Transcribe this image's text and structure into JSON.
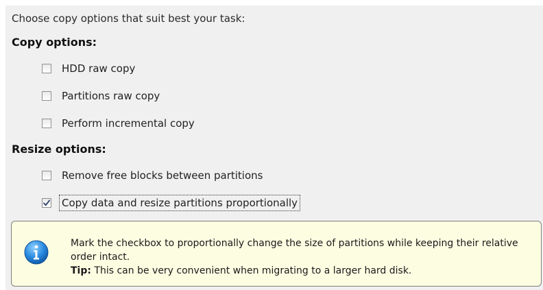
{
  "intro_text": "Choose copy options that suit best your task:",
  "copy_options": {
    "title": "Copy options:",
    "items": [
      {
        "label": "HDD raw copy",
        "checked": false
      },
      {
        "label": "Partitions raw copy",
        "checked": false
      },
      {
        "label": "Perform incremental copy",
        "checked": false
      }
    ]
  },
  "resize_options": {
    "title": "Resize options:",
    "items": [
      {
        "label": "Remove free blocks between partitions",
        "checked": false
      },
      {
        "label": "Copy data and resize partitions proportionally",
        "checked": true
      }
    ]
  },
  "tip": {
    "icon": "info-icon",
    "message": "Mark the checkbox to proportionally change the size of partitions while keeping their relative order intact.",
    "tip_label": "Tip:",
    "tip_text": " This can be very convenient when migrating to a larger hard disk."
  },
  "colors": {
    "panel_bg": "#f0f0f0",
    "tip_bg": "#fdfde2",
    "info_blue": "#1e7fd6"
  }
}
